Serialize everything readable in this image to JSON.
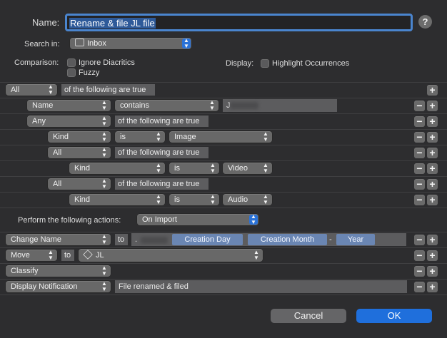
{
  "header": {
    "name_label": "Name:",
    "name_value": "Rename & file JL file",
    "help_glyph": "?",
    "search_label": "Search in:",
    "search_value": "Inbox",
    "comparison_label": "Comparison:",
    "ignore_diacritics": "Ignore Diacritics",
    "fuzzy": "Fuzzy",
    "display_label": "Display:",
    "highlight": "Highlight Occurrences"
  },
  "conditions": {
    "top_quantifier": "All",
    "top_suffix": "of the following are true",
    "row1": {
      "field": "Name",
      "op": "contains",
      "value": "J"
    },
    "row2": {
      "quantifier": "Any",
      "suffix": "of the following are true"
    },
    "row3": {
      "field": "Kind",
      "op": "is",
      "value": "Image"
    },
    "row4": {
      "quantifier": "All",
      "suffix": "of the following are true"
    },
    "row5": {
      "field": "Kind",
      "op": "is",
      "value": "Video"
    },
    "row6": {
      "quantifier": "All",
      "suffix": "of the following are true"
    },
    "row7": {
      "field": "Kind",
      "op": "is",
      "value": "Audio"
    }
  },
  "actions": {
    "perform_label": "Perform the following actions:",
    "trigger": "On Import",
    "a1": {
      "action": "Change Name",
      "to": "to",
      "dot": ".",
      "tok1": "Creation Day",
      "tok2": "Creation Month",
      "dash": "-",
      "tok3": "Year"
    },
    "a2": {
      "action": "Move",
      "to": "to",
      "dest": "JL"
    },
    "a3": {
      "action": "Classify"
    },
    "a4": {
      "action": "Display Notification",
      "text": "File renamed & filed"
    }
  },
  "buttons": {
    "cancel": "Cancel",
    "ok": "OK",
    "minus": "−",
    "plus": "+"
  },
  "colors": {
    "accent": "#1f6fdc",
    "token": "#6a86b3",
    "background": "#2d2d2f"
  },
  "icons": [
    "help-icon",
    "inbox-icon",
    "stack-icon",
    "chevron-updown-icon"
  ]
}
